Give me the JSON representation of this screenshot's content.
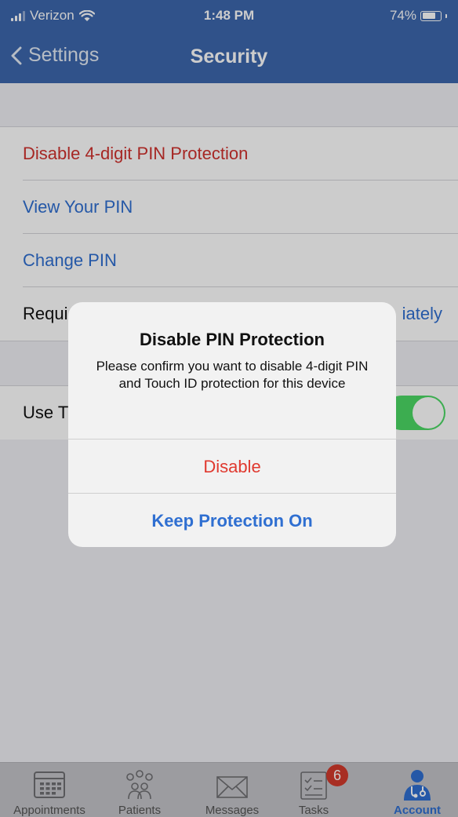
{
  "status_bar": {
    "carrier": "Verizon",
    "time": "1:48 PM",
    "battery_percent": "74%",
    "battery_level": 0.74
  },
  "nav": {
    "back_label": "Settings",
    "title": "Security"
  },
  "settings": {
    "disable_pin": "Disable 4-digit PIN Protection",
    "view_pin": "View Your PIN",
    "change_pin": "Change PIN",
    "require_label": "Requi",
    "require_value": "iately",
    "use_touch_label": "Use T",
    "use_touch_enabled": true
  },
  "alert": {
    "title": "Disable PIN Protection",
    "message": "Please confirm you want to disable 4-digit PIN and Touch ID protection for this device",
    "disable_button": "Disable",
    "keep_button": "Keep Protection On"
  },
  "tabs": [
    {
      "label": "Appointments",
      "icon": "calendar-icon"
    },
    {
      "label": "Patients",
      "icon": "people-icon"
    },
    {
      "label": "Messages",
      "icon": "envelope-icon"
    },
    {
      "label": "Tasks",
      "icon": "checklist-icon",
      "badge": "6"
    },
    {
      "label": "Account",
      "icon": "doctor-icon",
      "active": true
    }
  ],
  "colors": {
    "nav_blue": "#3c67ad",
    "destructive_red": "#d0312d",
    "link_blue": "#2f6fd1",
    "toggle_green": "#4cd964",
    "badge_red": "#d33a2c"
  }
}
